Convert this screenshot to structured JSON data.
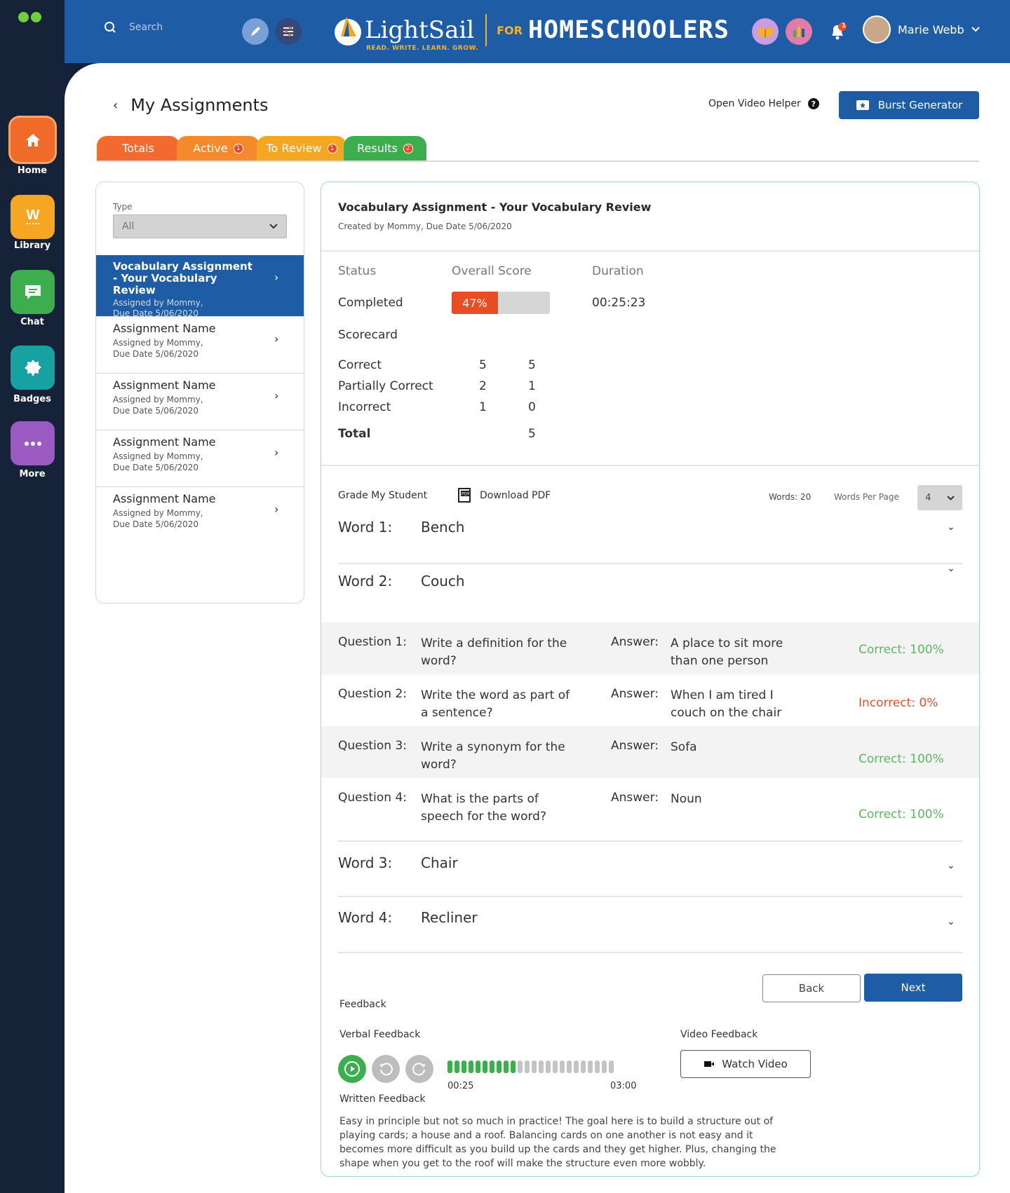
{
  "nav": {
    "items": [
      {
        "label": "Home",
        "icon": "home-icon",
        "color": "#f06a2a"
      },
      {
        "label": "Library",
        "icon": "library-icon",
        "color": "#f5a623"
      },
      {
        "label": "Chat",
        "icon": "chat-icon",
        "color": "#3cae4e"
      },
      {
        "label": "Badges",
        "icon": "badge-icon",
        "color": "#17a2a2"
      },
      {
        "label": "More",
        "icon": "more-icon",
        "color": "#9b59c2"
      }
    ]
  },
  "header": {
    "search_placeholder": "Search",
    "logo_name": "LightSail",
    "logo_tagline": "READ. WRITE. LEARN. GROW.",
    "logo_for": "FOR",
    "logo_homeschoolers": "HOMESCHOOLERS",
    "notification_count": "1",
    "user_name": "Marie Webb"
  },
  "page": {
    "title": "My Assignments",
    "video_helper": "Open Video Helper",
    "burst_button": "Burst Generator"
  },
  "tabs": [
    {
      "label": "Totals",
      "count": "",
      "color": "#f26a2d"
    },
    {
      "label": "Active",
      "count": "1",
      "color": "#f58a2d"
    },
    {
      "label": "To Review",
      "count": "1",
      "color": "#f5a623"
    },
    {
      "label": "Results",
      "count": "2",
      "color": "#3cae4e"
    }
  ],
  "list": {
    "type_label": "Type",
    "type_value": "All",
    "items": [
      {
        "name": "Vocabulary Assignment - Your Vocabulary Review",
        "by": "Assigned by Mommy,",
        "due": "Due Date 5/06/2020",
        "selected": true
      },
      {
        "name": "Assignment Name",
        "by": "Assigned by Mommy,",
        "due": "Due Date 5/06/2020"
      },
      {
        "name": "Assignment Name",
        "by": "Assigned by Mommy,",
        "due": "Due Date 5/06/2020"
      },
      {
        "name": "Assignment Name",
        "by": "Assigned by Mommy,",
        "due": "Due Date 5/06/2020"
      },
      {
        "name": "Assignment Name",
        "by": "Assigned by Mommy,",
        "due": "Due Date 5/06/2020"
      }
    ]
  },
  "detail": {
    "title": "Vocabulary Assignment - Your Vocabulary Review",
    "subtitle": "Created by Mommy, Due Date 5/06/2020",
    "status_label": "Status",
    "status_value": "Completed",
    "score_label": "Overall Score",
    "score_value": "47%",
    "score_fraction": 0.47,
    "duration_label": "Duration",
    "duration_value": "00:25:23",
    "scorecard_label": "Scorecard",
    "scorecard": [
      {
        "label": "Correct",
        "a": "5",
        "b": "5"
      },
      {
        "label": "Partially Correct",
        "a": "2",
        "b": "1"
      },
      {
        "label": "Incorrect",
        "a": "1",
        "b": "0"
      }
    ],
    "total_label": "Total",
    "total_value": "5",
    "grade_label": "Grade My Student",
    "download_label": "Download PDF",
    "words_count": "Words: 20",
    "words_per_page_label": "Words Per Page",
    "words_per_page_value": "4",
    "words": [
      {
        "label": "Word 1:",
        "word": "Bench"
      },
      {
        "label": "Word 2:",
        "word": "Couch"
      },
      {
        "label": "Word 3:",
        "word": "Chair"
      },
      {
        "label": "Word 4:",
        "word": "Recliner"
      }
    ],
    "questions": [
      {
        "label": "Question 1:",
        "text": "Write a definition for the word?",
        "answer_label": "Answer:",
        "answer": "A place to sit more than one person",
        "result": "Correct: 100%"
      },
      {
        "label": "Question 2:",
        "text": "Write the word as part of a sentence?",
        "answer_label": "Answer:",
        "answer": "When I am tired I couch on the chair",
        "result": "Incorrect: 0%"
      },
      {
        "label": "Question 3:",
        "text": "Write a synonym for the word?",
        "answer_label": "Answer:",
        "answer": "Sofa",
        "result": "Correct: 100%"
      },
      {
        "label": "Question 4:",
        "text": "What is the parts of speech for the word?",
        "answer_label": "Answer:",
        "answer": "Noun",
        "result": "Correct: 100%"
      }
    ],
    "back_button": "Back",
    "next_button": "Next",
    "feedback_label": "Feedback",
    "verbal_label": "Verbal Feedback",
    "video_label": "Video  Feedback",
    "watch_video": "Watch Video",
    "audio_current": "00:25",
    "audio_total": "03:00",
    "audio_progress": 0.42,
    "written_label": "Written Feedback",
    "written_text": "Easy in principle but not so much in practice! The goal here is to build a structure out of playing cards; a house and a roof. Balancing cards on one another is not easy and it becomes more difficult as you build up the cards and they get higher. Plus, changing the shape when you get to the roof will make the structure even more wobbly."
  }
}
